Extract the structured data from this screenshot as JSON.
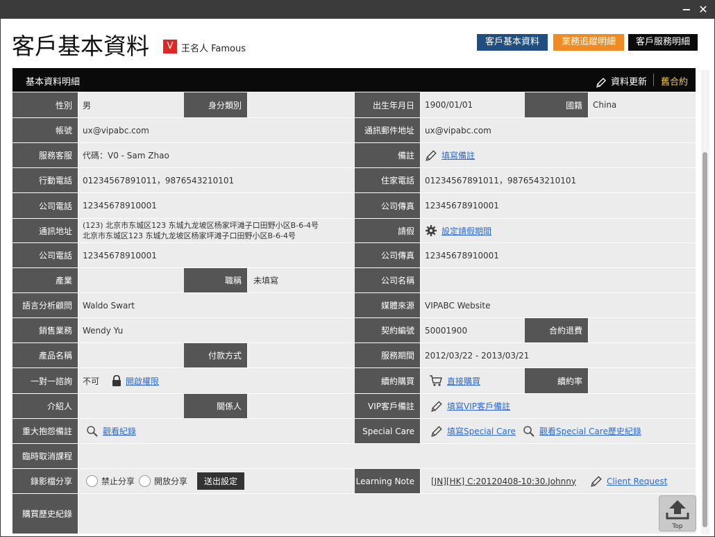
{
  "window": {
    "minimize_label": "−",
    "close_label": "✕"
  },
  "header": {
    "title": "客戶基本資料",
    "badge": "V",
    "user_name": "王名人 Famous",
    "nav": [
      "客戶基本資料",
      "業務追蹤明細",
      "客戶服務明細"
    ],
    "nav_colors": [
      "#1f4f82",
      "#f08a23",
      "#0b0b0b"
    ]
  },
  "section": {
    "title": "基本資料明細",
    "update_label": "資料更新",
    "old_contract_label": "舊合約"
  },
  "fields": {
    "gender_label": "性別",
    "gender": "男",
    "id_type_label": "身分類別",
    "birthday_label": "出生年月日",
    "birthday": "1900/01/01",
    "nationality_label": "國籍",
    "nationality": "China",
    "account_label": "帳號",
    "account": "ux@vipabc.com",
    "mail_label": "通訊郵件地址",
    "mail": "ux@vipabc.com",
    "service_label": "服務客服",
    "service": "代碼：V0 - Sam Zhao",
    "note_label": "備註",
    "note_link": "填寫備註",
    "mobile_label": "行動電話",
    "mobile": " 01234567891011，9876543210101",
    "home_label": "住家電話",
    "home": "01234567891011，9876543210101",
    "office_phone_label": "公司電話",
    "office_phone": "12345678910001",
    "office_fax_label": "公司傳真",
    "office_fax": "12345678910001",
    "address_label": "通訊地址",
    "address_1": "(123) 北京市东城区123 东城九龙坡区杨家坪滩子口田野小区B-6-4号",
    "address_2": "北京市东城区123 东城九龙坡区杨家坪滩子口田野小区B-6-4号",
    "leave_label": "請假",
    "leave_link": "設定請假期間",
    "office_phone2_label": "公司電話",
    "office_phone2": "12345678910001",
    "office_fax2_label": "公司傳真",
    "office_fax2": "12345678910001",
    "industry_label": "產業",
    "job_title_label": "職稱",
    "job_title": "未填寫",
    "company_label": "公司名稱",
    "consultant_label": "語言分析顧問",
    "consultant": "Waldo Swart",
    "media_label": "媒體來源",
    "media": "VIPABC Website",
    "sales_label": "銷售業務",
    "sales": "Wendy Yu",
    "contract_no_label": "契約編號",
    "contract_no": "50001900",
    "refund_label": "合約退費",
    "product_label": "產品名稱",
    "payment_label": "付款方式",
    "period_label": "服務期間",
    "period": "2012/03/22 - 2013/03/21",
    "consult_label": "一對一諮詢",
    "consult": "不可",
    "consult_link": "開啟權限",
    "renew_buy_label": "續約購買",
    "renew_buy_link": "直接購買",
    "renew_rate_label": "續約率",
    "referrer_label": "介紹人",
    "relation_label": "關係人",
    "vip_note_label": "VIP客戶備註",
    "vip_note_link": "填寫VIP客戶備註",
    "complaint_label": "重大抱怨備註",
    "complaint_link": "觀看紀錄",
    "special_care_label": "Special Care",
    "special_care_link": "填寫Special Care",
    "special_care_history_link": "觀看Special Care歷史紀錄",
    "cancel_label": "臨時取消課程",
    "video_label": "錄影檔分享",
    "video_opt1": "禁止分享",
    "video_opt2": "開放分享",
    "video_submit": "送出設定",
    "learning_label": "Learning Note",
    "learning_note": "[JN][HK] C:20120408-10:30.Johnny",
    "learning_link": "Client Request",
    "history_label": "購買歷史紀錄"
  },
  "top_button": {
    "label": "Top"
  }
}
